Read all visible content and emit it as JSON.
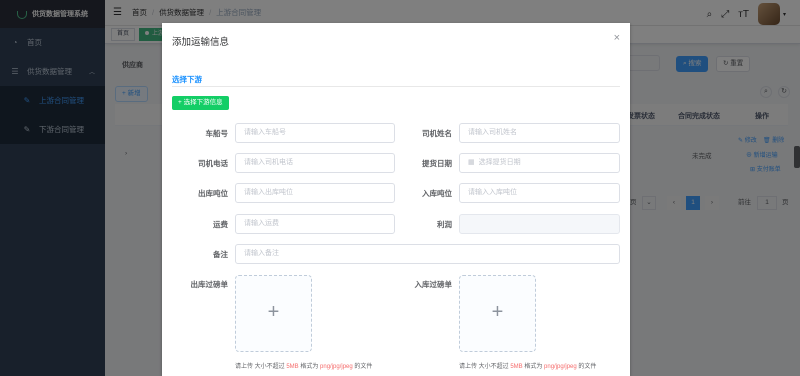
{
  "app": {
    "title": "供货数据管理系统"
  },
  "sidebar": {
    "items": [
      {
        "label": "首页",
        "icon": "dashboard-icon"
      },
      {
        "label": "供货数据管理",
        "icon": "menu-icon"
      }
    ],
    "sub_items": [
      {
        "label": "上游合同管理",
        "icon": "edit-icon"
      },
      {
        "label": "下游合同管理",
        "icon": "edit-icon"
      }
    ]
  },
  "breadcrumb": {
    "home": "首页",
    "parent": "供货数据管理",
    "current": "上游合同管理"
  },
  "tags": {
    "home": "首页",
    "active": "上游..."
  },
  "background": {
    "filter_label": "供应商",
    "filter_value": "3",
    "search_button": "搜索",
    "reset_button": "重置",
    "add_button": "+ 新增",
    "headers": [
      "发票状态",
      "合同完成状态",
      "操作"
    ],
    "row": {
      "status": "未完成",
      "actions": [
        "修改",
        "删除",
        "新增运输",
        "支付账单"
      ]
    },
    "pager_total": "页",
    "pager_page": "1",
    "pager_goto": "前往",
    "pager_goto_value": "1",
    "pager_unit": "页"
  },
  "dialog": {
    "title": "添加运输信息",
    "close": "×",
    "section": "选择下游",
    "select_button": "+ 选择下游信息",
    "fields": {
      "vessel_no": {
        "label": "车船号",
        "placeholder": "请输入车船号"
      },
      "driver_name": {
        "label": "司机姓名",
        "placeholder": "请输入司机姓名"
      },
      "driver_phone": {
        "label": "司机电话",
        "placeholder": "请输入司机电话"
      },
      "pickup_date": {
        "label": "提货日期",
        "placeholder": "选择提货日期"
      },
      "out_tonnage": {
        "label": "出库吨位",
        "placeholder": "请输入出库吨位"
      },
      "in_tonnage": {
        "label": "入库吨位",
        "placeholder": "请输入入库吨位"
      },
      "freight": {
        "label": "运费",
        "placeholder": "请输入运费"
      },
      "profit": {
        "label": "利润",
        "placeholder": ""
      },
      "remark": {
        "label": "备注",
        "placeholder": "请输入备注"
      }
    },
    "uploads": {
      "out": {
        "label": "出库过磅单"
      },
      "in": {
        "label": "入库过磅单"
      },
      "tip_prefix": "请上传 大小不超过 ",
      "tip_size": "5MB",
      "tip_middle": " 格式为 ",
      "tip_format": "png/jpg/jpeg",
      "tip_suffix": " 的文件"
    }
  }
}
